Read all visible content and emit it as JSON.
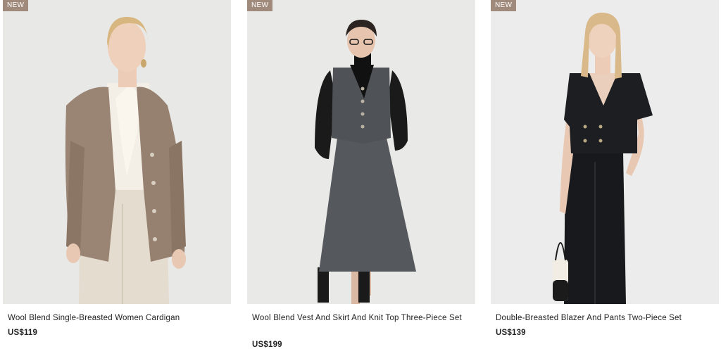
{
  "products": [
    {
      "badge": "NEW",
      "name": "Wool Blend Single-Breasted Women Cardigan",
      "price": "US$119"
    },
    {
      "badge": "NEW",
      "name": "Wool Blend Vest And Skirt And Knit Top Three-Piece Set",
      "price": "US$199"
    },
    {
      "badge": "NEW",
      "name": "Double-Breasted Blazer And Pants Two-Piece Set",
      "price": "US$139"
    }
  ],
  "colors": {
    "badge_bg": "#a08a7c",
    "photo_bg": "#ececec"
  }
}
